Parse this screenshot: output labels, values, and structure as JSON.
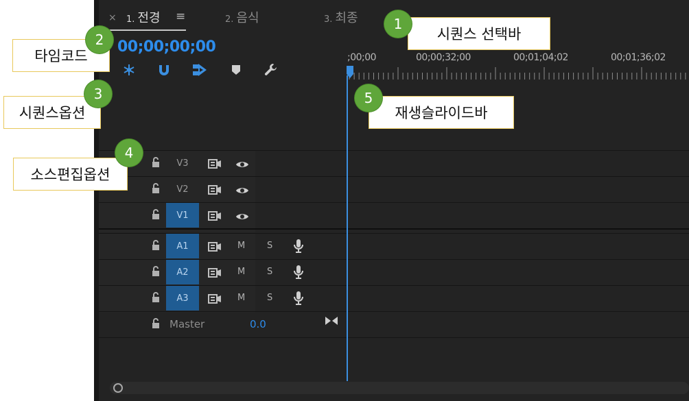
{
  "tabs": [
    {
      "num": "1.",
      "label": "전경"
    },
    {
      "num": "2.",
      "label": "음식"
    },
    {
      "num": "3.",
      "label": "최종"
    }
  ],
  "tab_close": "×",
  "tab_menu": "≡",
  "timecode": "00;00;00;00",
  "ruler": {
    "labels": [
      ";00;00",
      "00;00;32;00",
      "00;01;04;02",
      "00;01;36;02"
    ]
  },
  "tracks": {
    "video": [
      {
        "name": "V3",
        "selected": false
      },
      {
        "name": "V2",
        "selected": false
      },
      {
        "name": "V1",
        "selected": true
      }
    ],
    "audio": [
      {
        "name": "A1",
        "mute": "M",
        "solo": "S"
      },
      {
        "name": "A2",
        "mute": "M",
        "solo": "S"
      },
      {
        "name": "A3",
        "mute": "M",
        "solo": "S"
      }
    ],
    "master": {
      "label": "Master",
      "value": "0.0"
    }
  },
  "callouts": [
    {
      "num": "1",
      "text": "시퀀스 선택바"
    },
    {
      "num": "2",
      "text": "타임코드"
    },
    {
      "num": "3",
      "text": "시퀀스옵션"
    },
    {
      "num": "4",
      "text": "소스편집옵션"
    },
    {
      "num": "5",
      "text": "재생슬라이드바"
    }
  ],
  "colors": {
    "accent": "#2d8ceb",
    "selected_track": "#1f5c93",
    "callout_badge": "#5fa63a"
  }
}
